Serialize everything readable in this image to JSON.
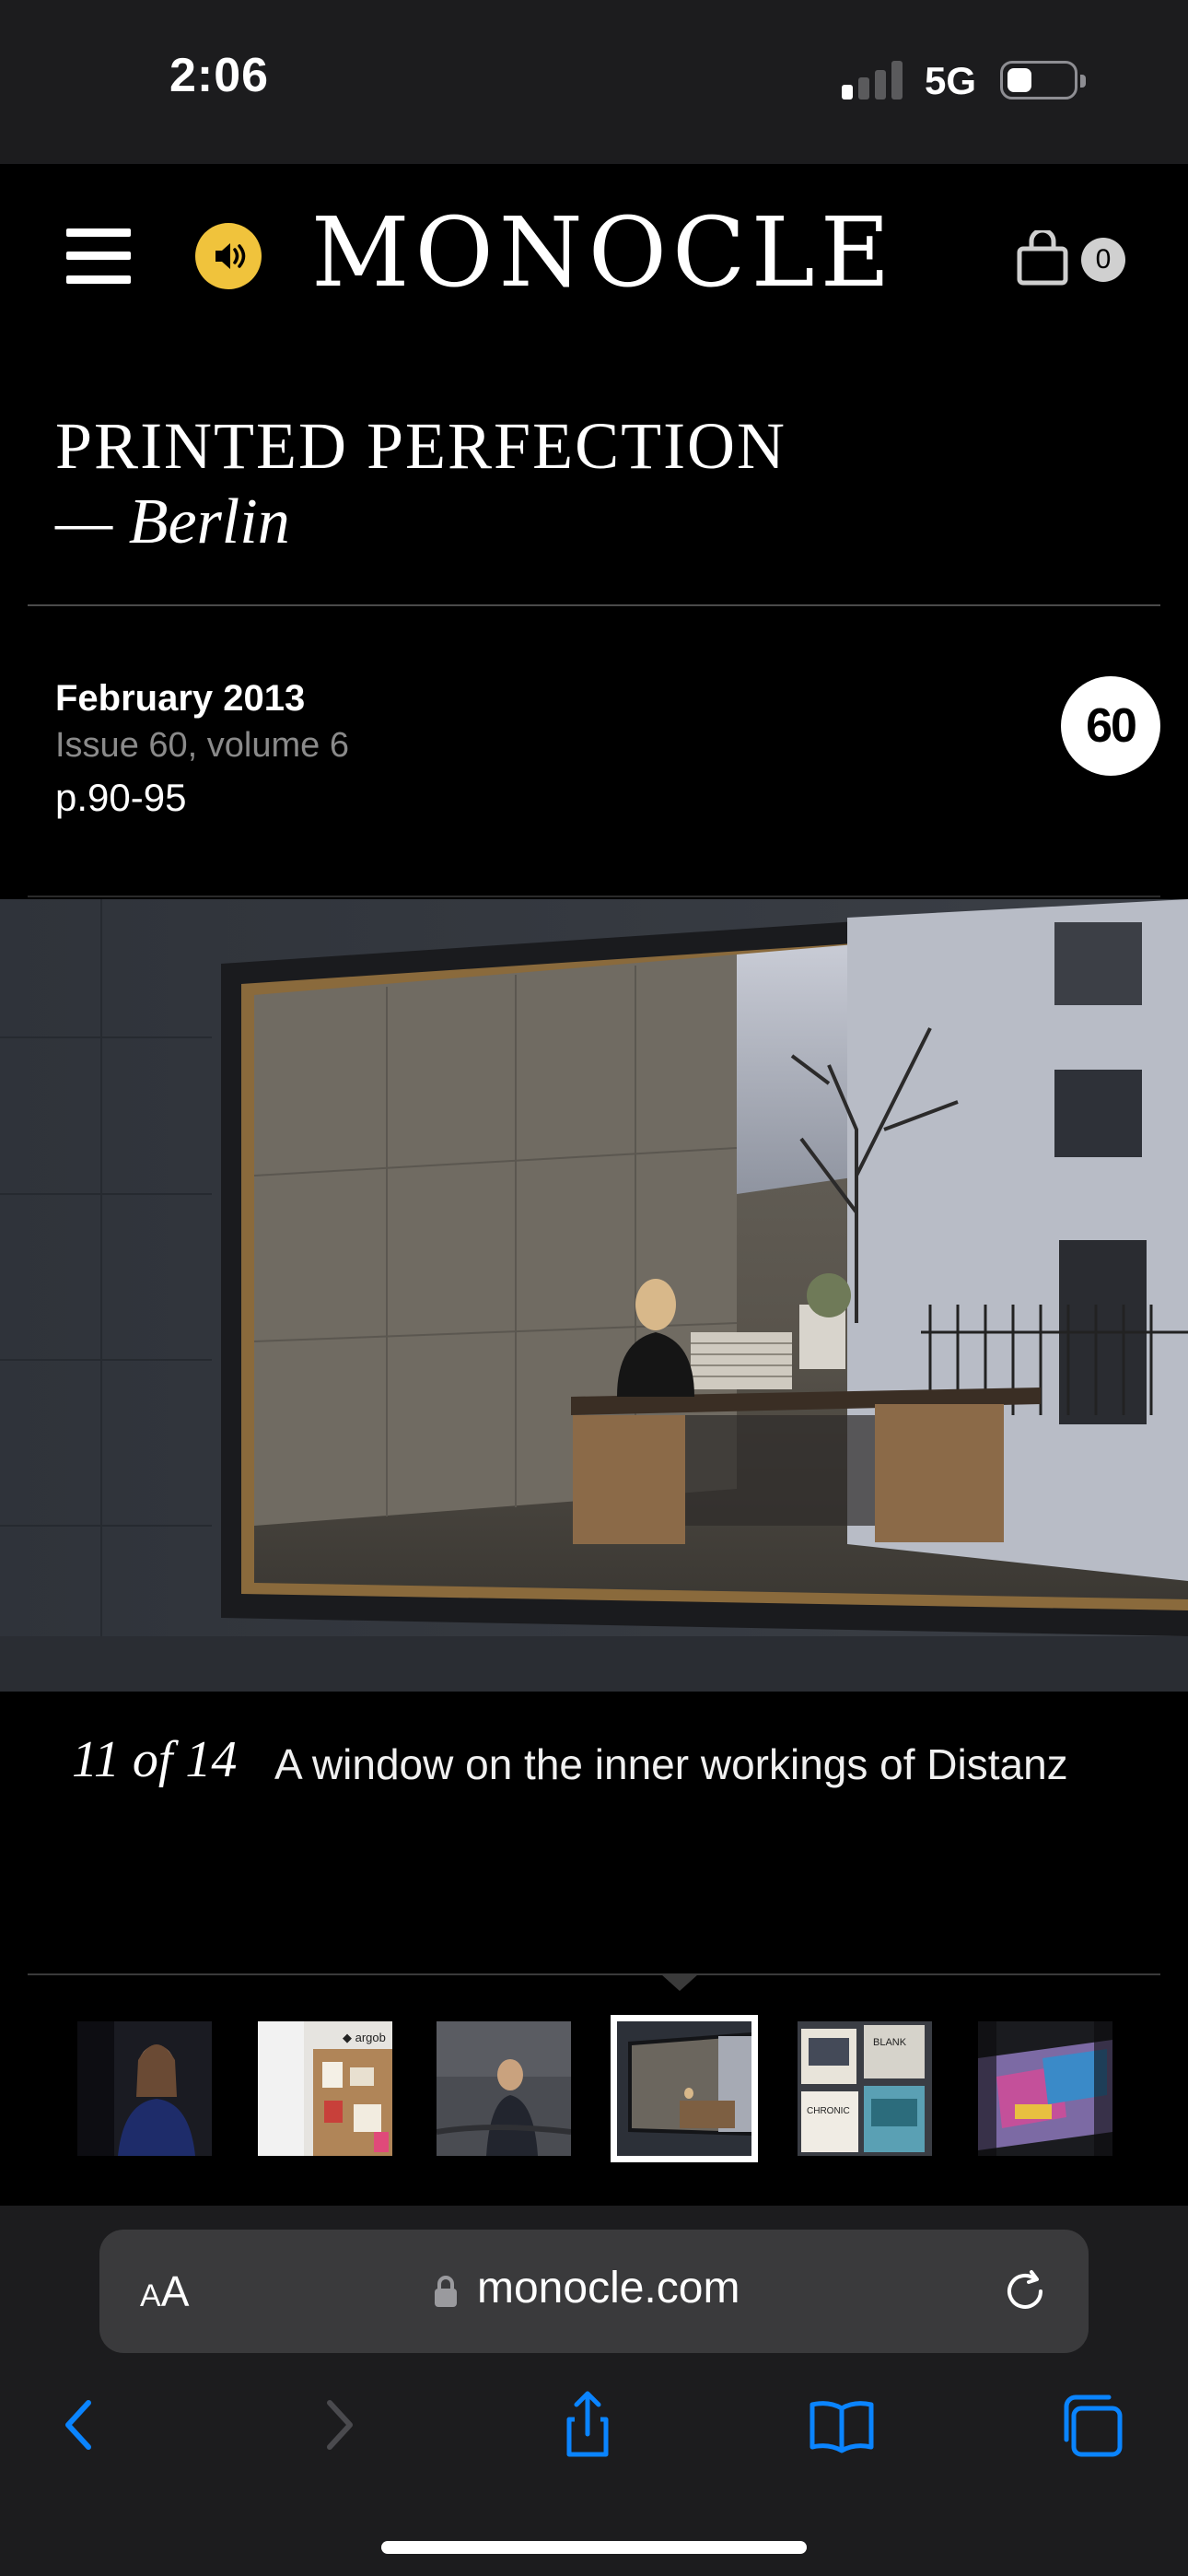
{
  "status_bar": {
    "time": "2:06",
    "network": "5G",
    "signal_bars_on": 1,
    "signal_bars_total": 4
  },
  "header": {
    "brand": "MONOCLE",
    "cart_count": "0",
    "brand_accent_color": "#f0c33c"
  },
  "article": {
    "title": "PRINTED PERFECTION",
    "subtitle": "— Berlin",
    "issue_date": "February 2013",
    "issue_volume": "Issue 60, volume 6",
    "pages": "p.90-95",
    "issue_badge": "60"
  },
  "gallery": {
    "counter": "11 of 14",
    "caption": "A window on the inner workings of Distanz",
    "current_index": 11,
    "total": 14,
    "active_thumb": 4,
    "thumbnails": [
      {
        "name": "thumb-portrait-woman"
      },
      {
        "name": "thumb-corkboard"
      },
      {
        "name": "thumb-woman-stairs"
      },
      {
        "name": "thumb-office-window"
      },
      {
        "name": "thumb-book-covers"
      },
      {
        "name": "thumb-colorful-print"
      }
    ]
  },
  "browser": {
    "aa_label_small": "A",
    "aa_label_large": "A",
    "url": "monocle.com",
    "accent_color": "#0a84ff"
  }
}
